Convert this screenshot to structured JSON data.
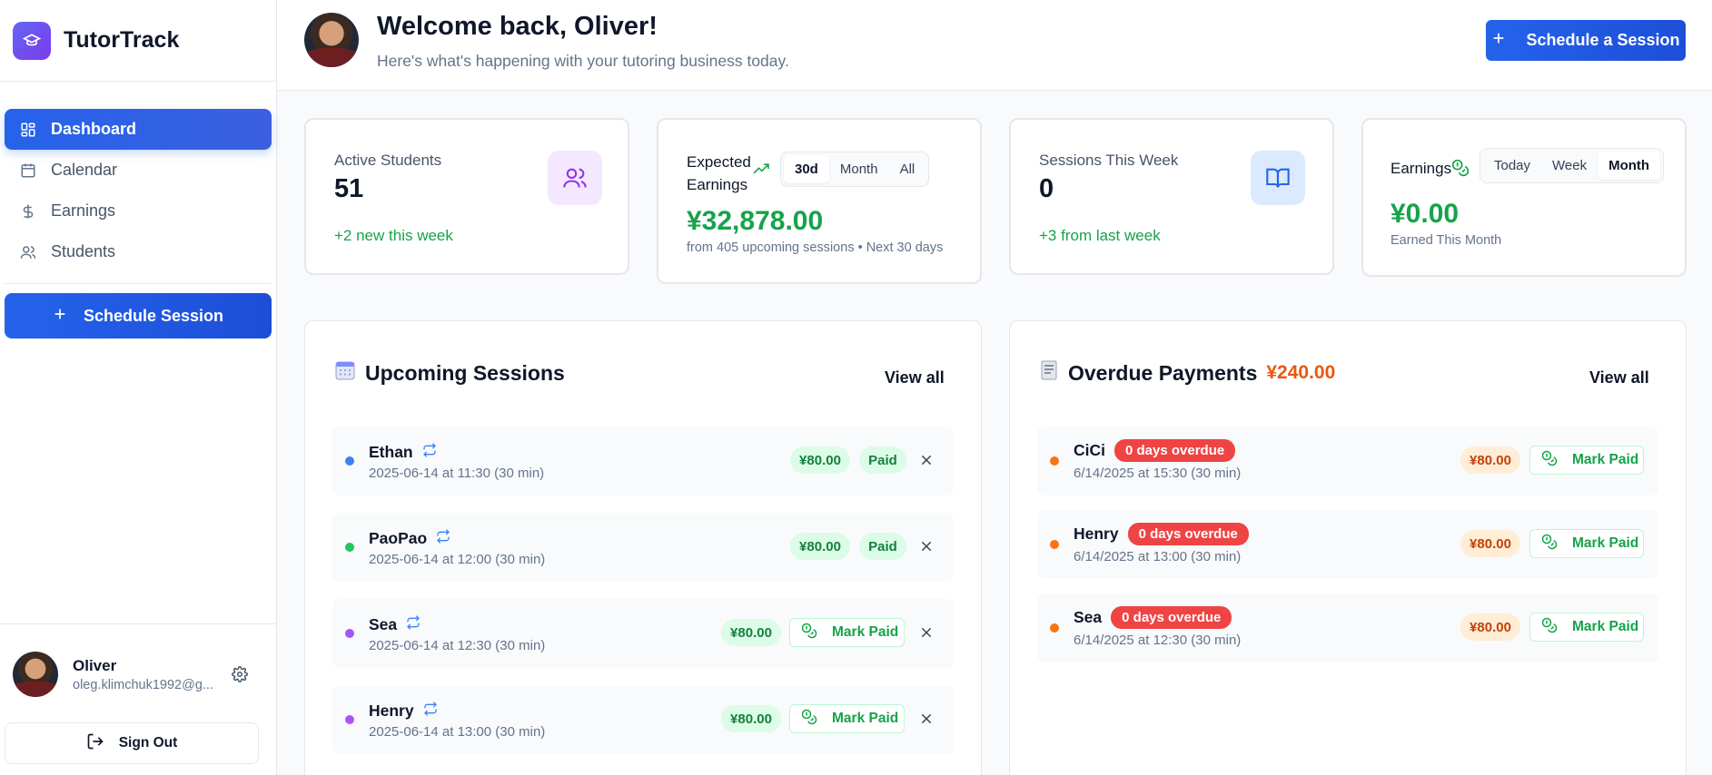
{
  "app": {
    "name": "TutorTrack"
  },
  "sidebar": {
    "items": [
      {
        "label": "Dashboard",
        "icon": "grid-icon",
        "active": true
      },
      {
        "label": "Calendar",
        "icon": "calendar-icon",
        "active": false
      },
      {
        "label": "Earnings",
        "icon": "dollar-icon",
        "active": false
      },
      {
        "label": "Students",
        "icon": "users-icon",
        "active": false
      }
    ],
    "schedule_button": "Schedule Session",
    "user": {
      "name": "Oliver",
      "email": "oleg.klimchuk1992@g..."
    },
    "sign_out": "Sign Out"
  },
  "header": {
    "title": "Welcome back, Oliver!",
    "subtitle": "Here's what's happening with your tutoring business today.",
    "button": "Schedule a Session"
  },
  "stats": {
    "active_students": {
      "label": "Active Students",
      "value": "51",
      "note": "+2 new this week"
    },
    "expected_earnings": {
      "label_line1": "Expected",
      "label_line2": "Earnings",
      "tabs": [
        "30d",
        "Month",
        "All"
      ],
      "selected_tab": "30d",
      "value": "¥32,878.00",
      "note": "from 405 upcoming sessions • Next 30 days"
    },
    "sessions_week": {
      "label": "Sessions This Week",
      "value": "0",
      "note": "+3 from last week"
    },
    "earnings": {
      "label": "Earnings",
      "tabs": [
        "Today",
        "Week",
        "Month"
      ],
      "selected_tab": "Month",
      "value": "¥0.00",
      "note": "Earned This Month"
    }
  },
  "upcoming": {
    "title": "Upcoming Sessions",
    "view_all": "View all",
    "rows": [
      {
        "name": "Ethan",
        "meta": "2025-06-14 at 11:30 (30 min)",
        "amount": "¥80.00",
        "status": "Paid",
        "dot_color": "#3b82f6"
      },
      {
        "name": "PaoPao",
        "meta": "2025-06-14 at 12:00 (30 min)",
        "amount": "¥80.00",
        "status": "Paid",
        "dot_color": "#22c55e"
      },
      {
        "name": "Sea",
        "meta": "2025-06-14 at 12:30 (30 min)",
        "amount": "¥80.00",
        "status": "Mark Paid",
        "dot_color": "#a855f7"
      },
      {
        "name": "Henry",
        "meta": "2025-06-14 at 13:00 (30 min)",
        "amount": "¥80.00",
        "status": "Mark Paid",
        "dot_color": "#a855f7"
      }
    ]
  },
  "overdue": {
    "title": "Overdue Payments",
    "total": "¥240.00",
    "view_all": "View all",
    "rows": [
      {
        "name": "CiCi",
        "badge": "0 days overdue",
        "meta": "6/14/2025 at 15:30 (30 min)",
        "amount": "¥80.00",
        "action": "Mark Paid"
      },
      {
        "name": "Henry",
        "badge": "0 days overdue",
        "meta": "6/14/2025 at 13:00 (30 min)",
        "amount": "¥80.00",
        "action": "Mark Paid"
      },
      {
        "name": "Sea",
        "badge": "0 days overdue",
        "meta": "6/14/2025 at 12:30 (30 min)",
        "amount": "¥80.00",
        "action": "Mark Paid"
      }
    ]
  },
  "colors": {
    "primary": "#2563eb",
    "success": "#16a34a",
    "danger": "#ef4444",
    "warning": "#ea580c"
  }
}
